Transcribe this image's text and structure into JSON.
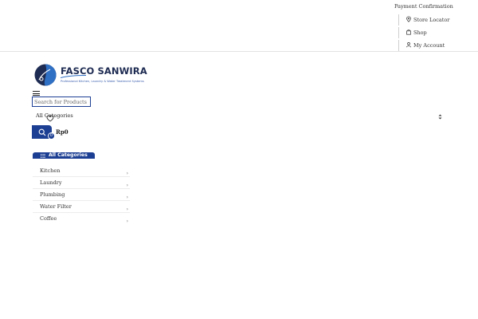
{
  "header": {
    "top_links": {
      "payment": "Payment Confirmation",
      "store_locator": "Store Locator",
      "shop": "Shop",
      "account": "My Account"
    }
  },
  "logo": {
    "name": "FASCO SANWIRA",
    "tagline": "Professional Kitchen, Laundry & Water Treatment Systems"
  },
  "search": {
    "placeholder": "Search for Products",
    "category_selected": "All Categories"
  },
  "cart": {
    "total": "Rp0",
    "count": "0"
  },
  "categories": {
    "heading": "All Categories",
    "items": [
      {
        "label": "Kitchen"
      },
      {
        "label": "Laundry"
      },
      {
        "label": "Plumbing"
      },
      {
        "label": "Water Filter"
      },
      {
        "label": "Coffee"
      }
    ]
  },
  "colors": {
    "brand_blue": "#1d3f93",
    "logo_navy": "#1e2b52"
  },
  "icons": [
    "map-pin-icon",
    "bag-icon",
    "user-icon",
    "menu-icon",
    "heart-icon",
    "search-icon",
    "list-icon",
    "chevron-right-icon",
    "select-arrows-icon"
  ]
}
